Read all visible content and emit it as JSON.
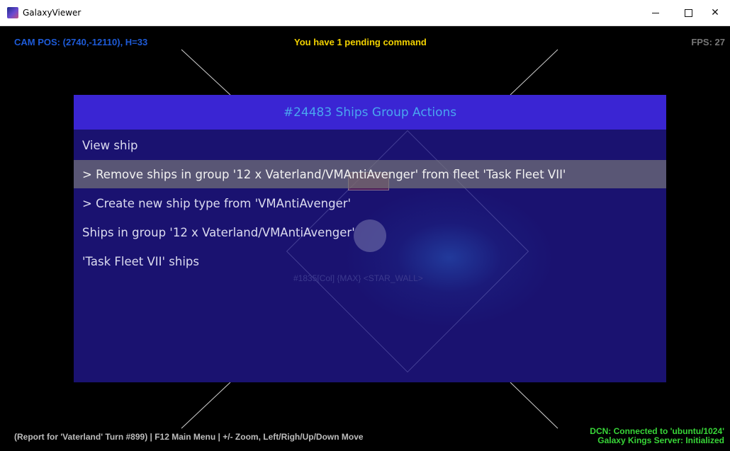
{
  "window": {
    "title": "GalaxyViewer",
    "icon": "galaxy-app-icon",
    "controls": {
      "minimize": "minimize-icon",
      "maximize": "maximize-icon",
      "close": "✕"
    }
  },
  "hud": {
    "cam_pos": "CAM POS: (2740,-12110), H=33",
    "pending": "You have 1 pending command",
    "fps": "FPS: 27",
    "report": "(Report for 'Vaterland' Turn #899) | F12 Main Menu | +/- Zoom, Left/Righ/Up/Down Move",
    "dcn_line1": "DCN: Connected to 'ubuntu/1024'",
    "dcn_line2": "Galaxy Kings Server: Initialized"
  },
  "panel": {
    "title": "#24483 Ships Group Actions",
    "items": [
      {
        "label": "View ship",
        "selected": false
      },
      {
        "label": "> Remove ships in group '12 x Vaterland/VMAntiAvenger' from fleet 'Task Fleet VII'",
        "selected": true
      },
      {
        "label": "> Create new ship type from 'VMAntiAvenger'",
        "selected": false
      },
      {
        "label": "Ships in group '12 x Vaterland/VMAntiAvenger'",
        "selected": false
      },
      {
        "label": "'Task Fleet VII' ships",
        "selected": false
      }
    ]
  },
  "background": {
    "star_label": "#1835[Col] {MAX} <STAR_WALL>"
  },
  "colors": {
    "panel_bg": "#1a1270",
    "header_bg": "#3a25d3",
    "header_text": "#4aa6ef",
    "cam_text": "#1e5bd8",
    "pending_text": "#f2d200",
    "dcn_text": "#38d638"
  }
}
